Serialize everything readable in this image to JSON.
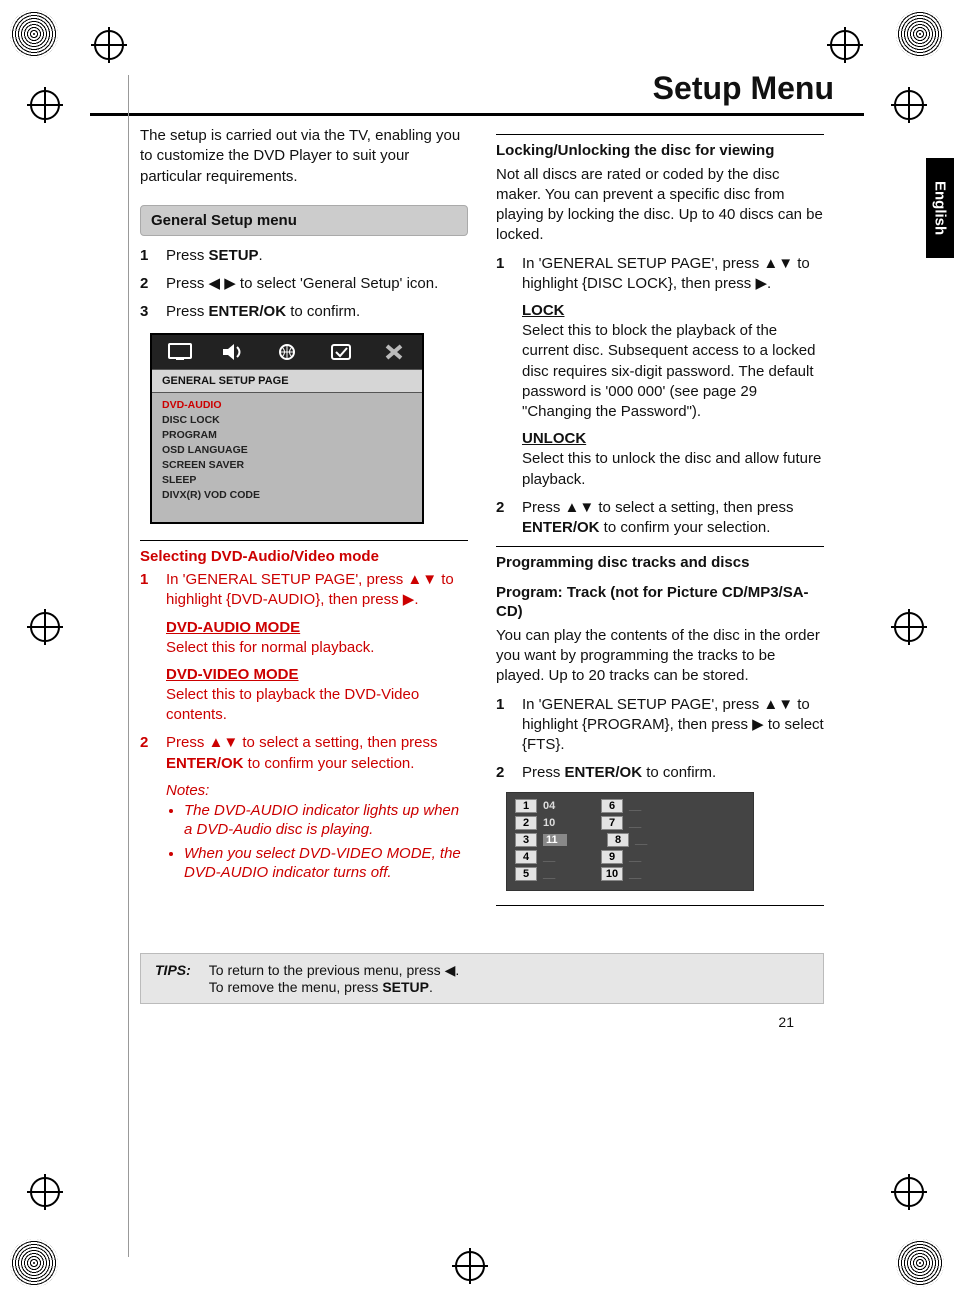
{
  "page": {
    "title": "Setup Menu",
    "number": "21",
    "language_tab": "English"
  },
  "intro": "The setup is carried out via the TV, enabling you to customize the DVD Player to suit your particular requirements.",
  "section_general": "General Setup menu",
  "steps_general": {
    "s1a": "Press ",
    "s1b": "SETUP",
    "s1c": ".",
    "s2a": "Press ",
    "s2arrows": "◀ ▶",
    "s2b": " to select 'General Setup' icon.",
    "s3a": "Press ",
    "s3b": "ENTER/OK",
    "s3c": " to confirm."
  },
  "osd": {
    "title": "GENERAL SETUP PAGE",
    "items": [
      "DVD-AUDIO",
      "DISC LOCK",
      "PROGRAM",
      "OSD LANGUAGE",
      "SCREEN SAVER",
      "SLEEP",
      "DIVX(R) VOD CODE"
    ]
  },
  "dvdav": {
    "heading": "Selecting DVD-Audio/Video mode",
    "s1a": "In 'GENERAL SETUP PAGE', press ",
    "s1arrows": "▲▼",
    "s1b": " to highlight {DVD-AUDIO}, then press ",
    "s1arrow2": "▶",
    "s1c": ".",
    "mode1": "DVD-AUDIO MODE",
    "mode1txt": "Select this for normal playback.",
    "mode2": "DVD-VIDEO MODE",
    "mode2txt": "Select this to playback the DVD-Video contents.",
    "s2a": "Press ",
    "s2arrows": "▲▼",
    "s2b": " to select a setting, then press ",
    "s2c": "ENTER/OK",
    "s2d": " to confirm your selection.",
    "notes_lbl": "Notes:",
    "note1": "The DVD-AUDIO indicator lights up when a DVD-Audio disc is playing.",
    "note2": "When you select DVD-VIDEO MODE, the DVD-AUDIO indicator turns off."
  },
  "lock": {
    "heading": "Locking/Unlocking the disc for viewing",
    "intro": "Not all discs are rated or coded by the disc maker. You can prevent a specific disc from playing by locking the disc. Up to 40 discs can be locked.",
    "s1a": "In 'GENERAL SETUP PAGE', press ",
    "s1arrows": "▲▼",
    "s1b": " to highlight {DISC LOCK}, then press ",
    "s1arrow2": "▶",
    "s1c": ".",
    "lock_h": "LOCK",
    "lock_txt": "Select this to block the playback of the current disc. Subsequent access to a locked disc requires six-digit password. The default password is '000 000' (see page 29 \"Changing the Password\").",
    "unlock_h": "UNLOCK",
    "unlock_txt": "Select this to unlock the disc and allow future playback.",
    "s2a": "Press ",
    "s2arrows": "▲▼",
    "s2b": " to select a setting, then press ",
    "s2c": "ENTER/OK",
    "s2d": " to confirm your selection."
  },
  "prog": {
    "heading": "Programming disc tracks and discs",
    "sub": "Program: Track (not for Picture CD/MP3/SA-CD)",
    "intro": "You can play the contents of the disc in the order you want by programming the tracks to be played. Up to 20 tracks can be stored.",
    "s1a": "In 'GENERAL SETUP PAGE', press ",
    "s1arrows": "▲▼",
    "s1b": " to highlight {PROGRAM}, then press ",
    "s1arrow2": "▶",
    "s1c": " to select {FTS}.",
    "s2a": "Press ",
    "s2b": "ENTER/OK",
    "s2c": " to confirm."
  },
  "track_table": {
    "left": [
      {
        "n": "1",
        "v": "04"
      },
      {
        "n": "2",
        "v": "10"
      },
      {
        "n": "3",
        "v": "11",
        "hl": true
      },
      {
        "n": "4",
        "v": "__"
      },
      {
        "n": "5",
        "v": "__"
      }
    ],
    "right": [
      {
        "n": "6",
        "v": "__"
      },
      {
        "n": "7",
        "v": "__"
      },
      {
        "n": "8",
        "v": "__"
      },
      {
        "n": "9",
        "v": "__"
      },
      {
        "n": "10",
        "v": "__"
      }
    ]
  },
  "tips": {
    "label": "TIPS:",
    "line1a": "To return to the previous menu, press ",
    "line1b": "◀",
    "line1c": ".",
    "line2a": "To remove the menu, press ",
    "line2b": "SETUP",
    "line2c": "."
  }
}
